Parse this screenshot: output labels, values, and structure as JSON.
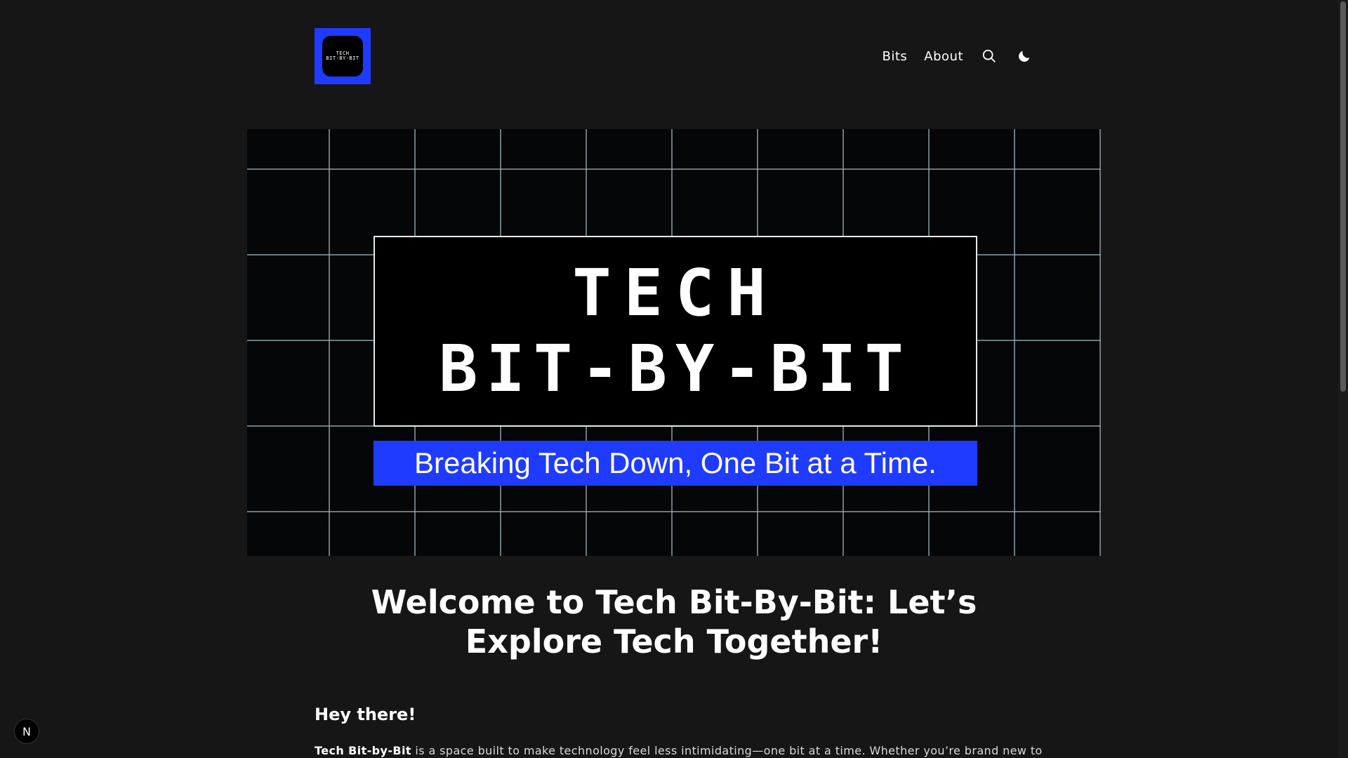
{
  "header": {
    "logo": {
      "line1": "TECH",
      "line2": "BIT-BY-BIT"
    },
    "nav": [
      {
        "label": "Bits"
      },
      {
        "label": "About"
      }
    ],
    "icons": [
      "search-icon",
      "moon-icon"
    ]
  },
  "hero": {
    "line1": "TECH",
    "line2": "BIT-BY-BIT",
    "tagline": "Breaking Tech Down, One Bit at a Time."
  },
  "main": {
    "title_line1": "Welcome to Tech Bit-By-Bit: Let’s",
    "title_line2": "Explore Tech Together!",
    "subheading": "Hey there!",
    "intro_bold": "Tech Bit-by-Bit",
    "intro_rest": " is a space built to make technology feel less intimidating—one bit at a time. Whether you’re brand new to"
  },
  "badge": {
    "label": "N"
  },
  "colors": {
    "background": "#161616",
    "accent": "#1f3bff",
    "text": "#ffffff"
  },
  "scrollbar": {
    "position": 0
  }
}
